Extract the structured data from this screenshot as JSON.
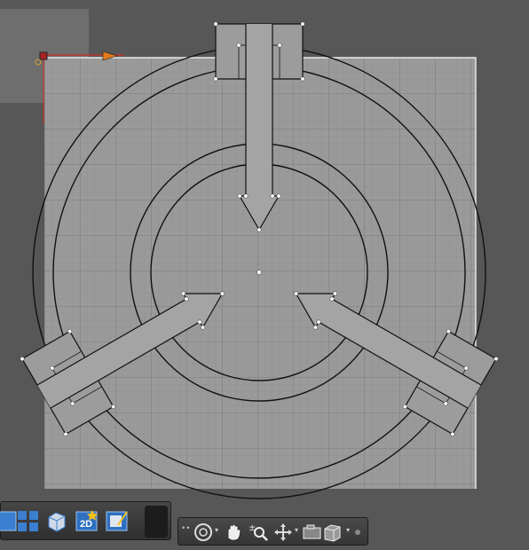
{
  "canvas": {
    "background": "#5a5a5a",
    "sheet_color": "#9c9c9c",
    "grid_color": "#8a8a8a",
    "outline_color": "#111111"
  },
  "view_toolbar": {
    "buttons": [
      {
        "name": "single-view-icon"
      },
      {
        "name": "quad-view-icon"
      },
      {
        "name": "3d-view-icon"
      },
      {
        "name": "2d-view-icon",
        "label": "2D"
      },
      {
        "name": "render-view-icon"
      }
    ]
  },
  "nav_toolbar": {
    "buttons": [
      {
        "name": "orbit-icon"
      },
      {
        "name": "pan-icon"
      },
      {
        "name": "zoom-icon"
      },
      {
        "name": "move-icon"
      },
      {
        "name": "camera-icon"
      },
      {
        "name": "view-cube-icon"
      }
    ]
  }
}
